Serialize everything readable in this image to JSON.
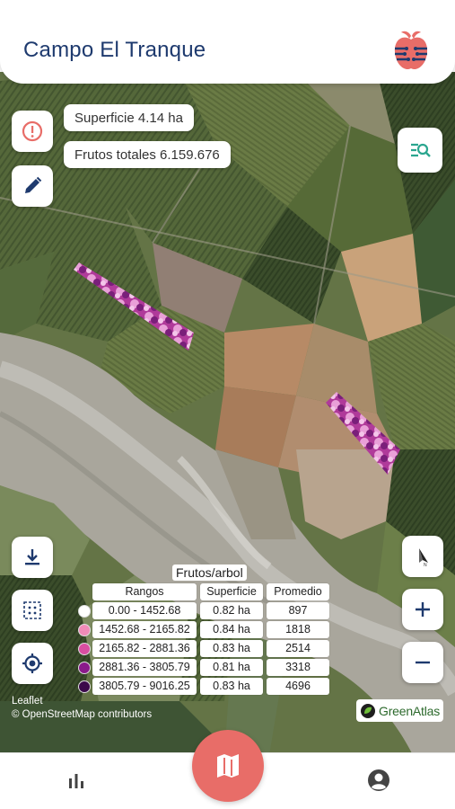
{
  "header": {
    "title": "Campo El Tranque",
    "logo_icon": "apple-circuit-logo"
  },
  "map": {
    "info_pills": {
      "surface": "Superficie 4.14 ha",
      "fruits": "Frutos totales 6.159.676"
    },
    "buttons": {
      "info": "info-icon",
      "edit": "pencil-icon",
      "search_list": "list-search-icon",
      "download": "download-icon",
      "grid": "grid-select-icon",
      "locate": "target-icon",
      "compass": "compass-icon",
      "zoom_in": "+",
      "zoom_out": "−"
    },
    "attribution": {
      "leaflet": "Leaflet",
      "osm": "© OpenStreetMap contributors"
    },
    "brand": "GreenAtlas",
    "colors": {
      "accent": "#1e3a6e",
      "teal": "#2ba68f",
      "map_button": "#e86d68"
    }
  },
  "legend": {
    "title": "Frutos/arbol",
    "headers": [
      "Rangos",
      "Superficie",
      "Promedio"
    ],
    "rows": [
      {
        "color": "#ffffff",
        "range": "0.00 - 1452.68",
        "surface": "0.82 ha",
        "avg": "897"
      },
      {
        "color": "#f08bb8",
        "range": "1452.68 - 2165.82",
        "surface": "0.84 ha",
        "avg": "1818"
      },
      {
        "color": "#d94ea1",
        "range": "2165.82 - 2881.36",
        "surface": "0.83 ha",
        "avg": "2514"
      },
      {
        "color": "#8a1a8a",
        "range": "2881.36 - 3805.79",
        "surface": "0.81 ha",
        "avg": "3318"
      },
      {
        "color": "#3b0a4a",
        "range": "3805.79 - 9016.25",
        "surface": "0.83 ha",
        "avg": "4696"
      }
    ]
  },
  "bottom_nav": {
    "stats": "bar-chart-icon",
    "map": "map-icon",
    "profile": "user-circle-icon"
  }
}
